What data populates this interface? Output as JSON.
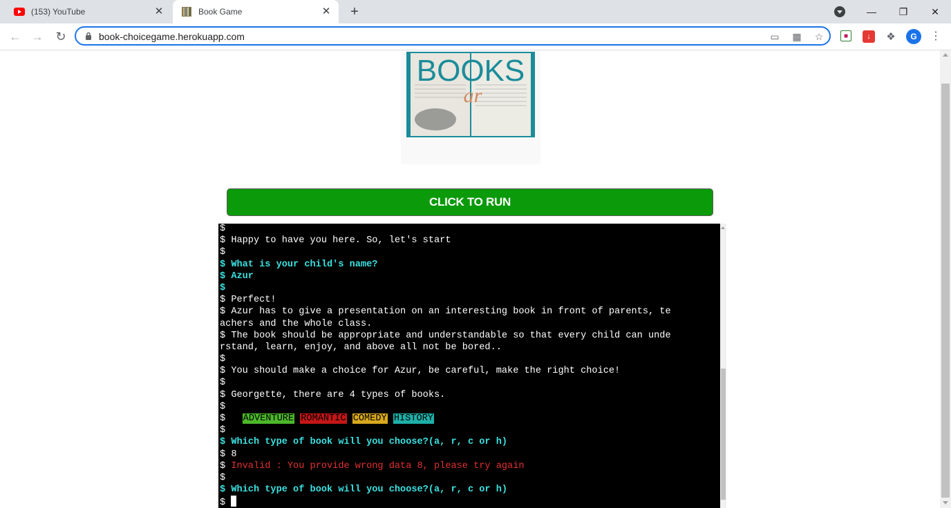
{
  "browser": {
    "tabs": [
      {
        "title": "(153) YouTube",
        "active": false,
        "icon": "youtube-icon"
      },
      {
        "title": "Book Game",
        "active": true,
        "icon": "book-icon"
      }
    ],
    "address": "book-choicegame.herokuapp.com"
  },
  "page": {
    "logo": {
      "title_text": "BOOKS",
      "sub_text": "ar"
    },
    "run_button": "CLICK TO RUN"
  },
  "terminal": {
    "prompt": "$",
    "lines": [
      {
        "text": "",
        "style": "plain"
      },
      {
        "text": "Happy to have you here. So, let's start",
        "style": "plain"
      },
      {
        "text": "",
        "style": "plain"
      },
      {
        "text": "What is your child's name?",
        "style": "cyan"
      },
      {
        "text": "Azur",
        "style": "cyan"
      },
      {
        "text": "",
        "style": "cyan"
      },
      {
        "text": "Perfect!",
        "style": "plain"
      },
      {
        "text": "Azur has to give a presentation on an interesting book in front of parents, te",
        "style": "plain"
      },
      {
        "text": "achers and the whole class.",
        "style": "plain",
        "noprompt": true
      },
      {
        "text": "The book should be appropriate and understandable so that every child can unde",
        "style": "plain"
      },
      {
        "text": "rstand, learn, enjoy, and above all not be bored..",
        "style": "plain",
        "noprompt": true
      },
      {
        "text": "",
        "style": "plain"
      },
      {
        "text": "You should make a choice for Azur, be careful, make the right choice!",
        "style": "plain"
      },
      {
        "text": "",
        "style": "plain"
      },
      {
        "text": "Georgette, there are 4 types of books.",
        "style": "plain"
      },
      {
        "text": "",
        "style": "plain"
      },
      {
        "text": "",
        "style": "badges"
      },
      {
        "text": "",
        "style": "plain"
      },
      {
        "text": "Which type of book will you choose?(a, r, c or h)",
        "style": "cyan"
      },
      {
        "text": "8",
        "style": "plain"
      },
      {
        "text": "Invalid : You provide wrong data 8, please try again",
        "style": "red"
      },
      {
        "text": "",
        "style": "plain"
      },
      {
        "text": "Which type of book will you choose?(a, r, c or h)",
        "style": "cyan"
      },
      {
        "text": "",
        "style": "cursor"
      }
    ],
    "badges": [
      {
        "label": "ADVENTURE",
        "color": "#4cb82a"
      },
      {
        "label": "ROMANTIC",
        "color": "#c41616"
      },
      {
        "label": "COMEDY",
        "color": "#d8a81e"
      },
      {
        "label": "HISTORY",
        "color": "#1eb0a8"
      }
    ]
  },
  "colors": {
    "run_button": "#0a9a0a",
    "terminal_bg": "#000000",
    "prompt_cyan": "#3ce0e0",
    "error_red": "#e53030",
    "omnibox_focus": "#1a73e8"
  }
}
